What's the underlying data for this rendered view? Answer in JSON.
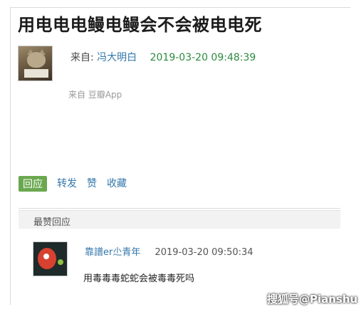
{
  "post": {
    "title": "用电电电鳗电鳗会不会被电电死",
    "from_label": "来自:",
    "author": "冯大明白",
    "timestamp": "2019-03-20 09:48:39",
    "source": "来自 豆瓣App"
  },
  "actions": {
    "reply": "回应",
    "repost": "转发",
    "like": "赞",
    "collect": "收藏"
  },
  "best_replies": {
    "header": "最赞回应",
    "items": [
      {
        "author": "靠譜er尐青年",
        "timestamp": "2019-03-20 09:50:34",
        "text": "用毒毒毒蛇蛇会被毒毒死吗"
      }
    ]
  },
  "watermark": "搜狐号@Pianshu"
}
